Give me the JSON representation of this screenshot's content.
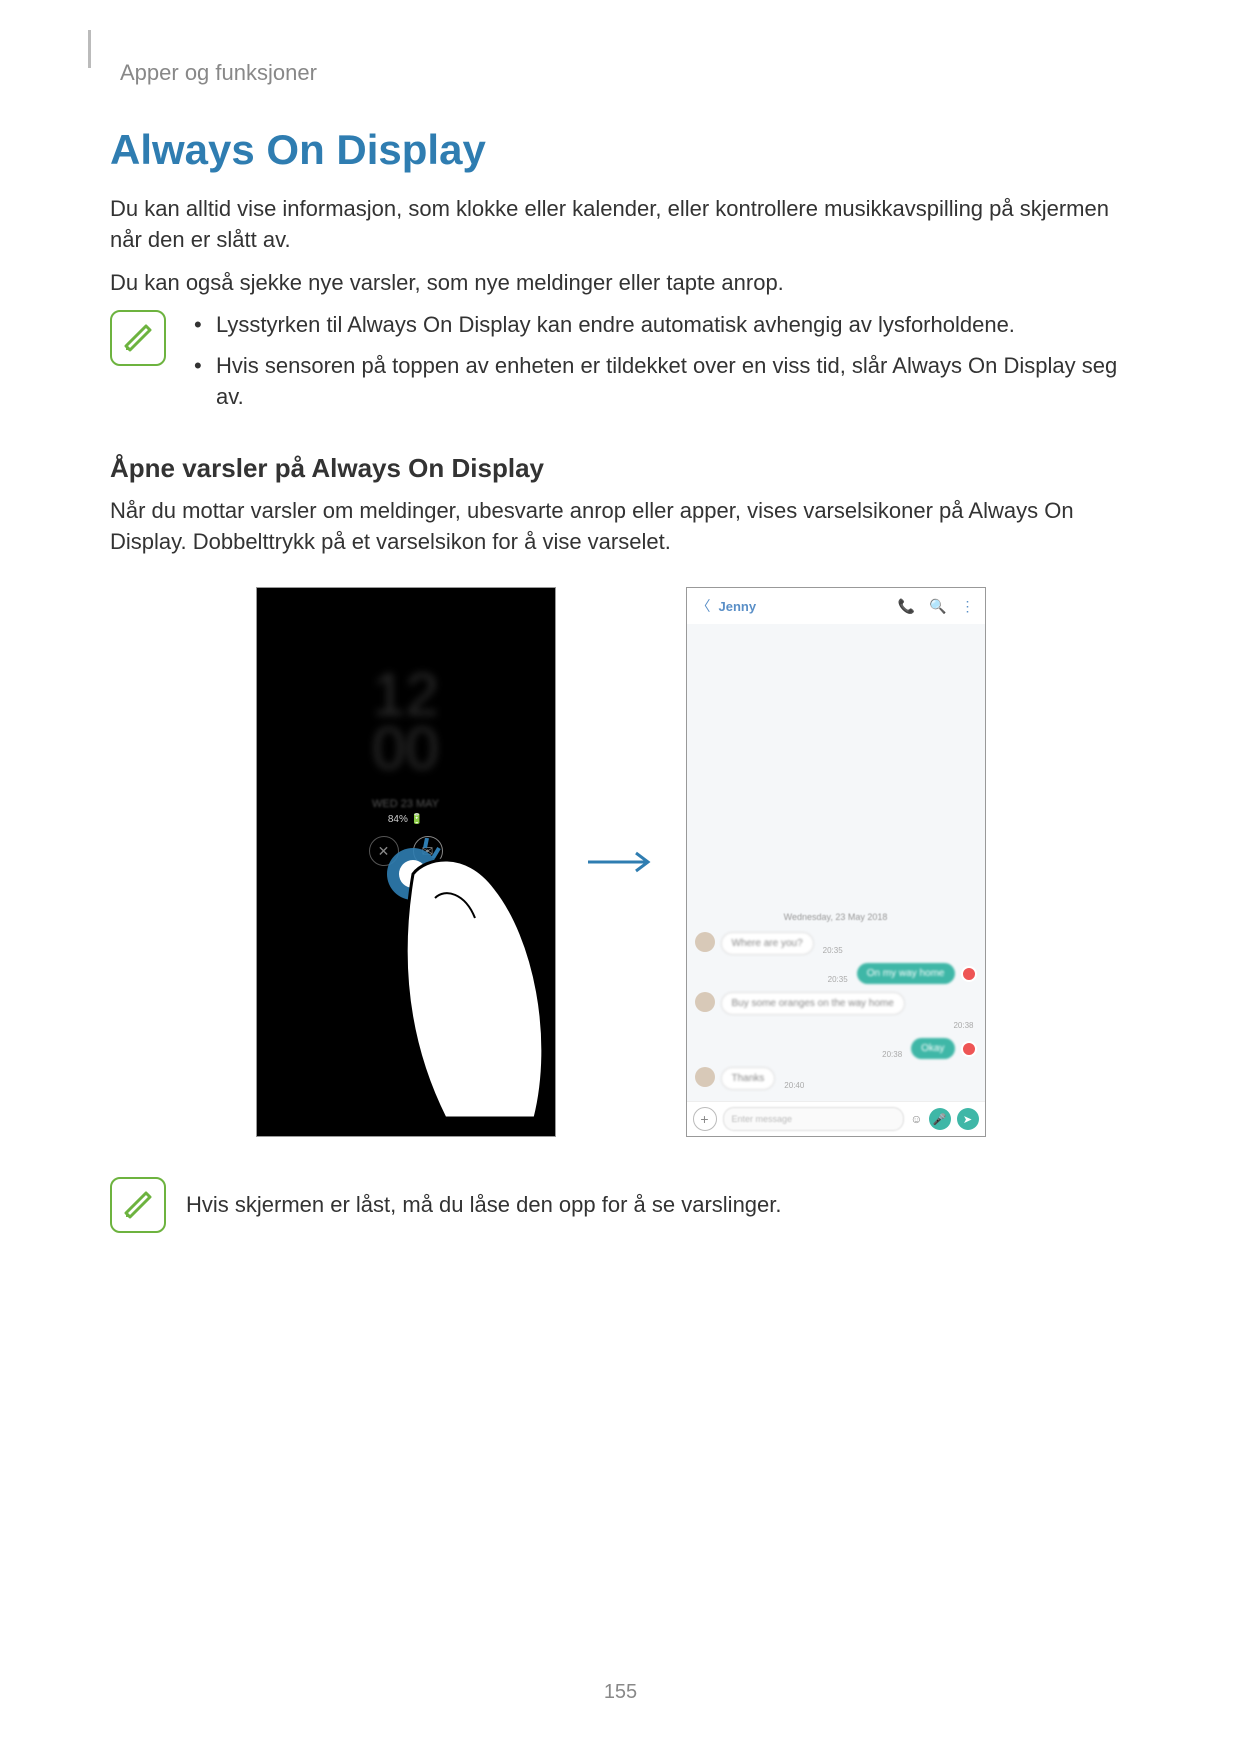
{
  "header": {
    "section": "Apper og funksjoner"
  },
  "title": "Always On Display",
  "intro_p1": "Du kan alltid vise informasjon, som klokke eller kalender, eller kontrollere musikkavspilling på skjermen når den er slått av.",
  "intro_p2": "Du kan også sjekke nye varsler, som nye meldinger eller tapte anrop.",
  "note1": {
    "b1": "Lysstyrken til Always On Display kan endre automatisk avhengig av lysforholdene.",
    "b2": "Hvis sensoren på toppen av enheten er tildekket over en viss tid, slår Always On Display seg av."
  },
  "subheading": "Åpne varsler på Always On Display",
  "sub_p1": "Når du mottar varsler om meldinger, ubesvarte anrop eller apper, vises varselsikoner på Always On Display. Dobbelttrykk på et varselsikon for å vise varselet.",
  "note2": "Hvis skjermen er låst, må du låse den opp for å se varslinger.",
  "aod": {
    "clock_top": "12",
    "clock_bottom": "00",
    "date": "WED 23 MAY",
    "batt": "84% 🔋"
  },
  "chat": {
    "name": "Jenny",
    "date": "Wednesday, 23 May 2018",
    "m1": "Where are you?",
    "m2": "On my way home",
    "m3": "Buy some oranges on the way home",
    "m4": "Okay",
    "m5": "Thanks",
    "input_placeholder": "Enter message"
  },
  "page_number": "155"
}
